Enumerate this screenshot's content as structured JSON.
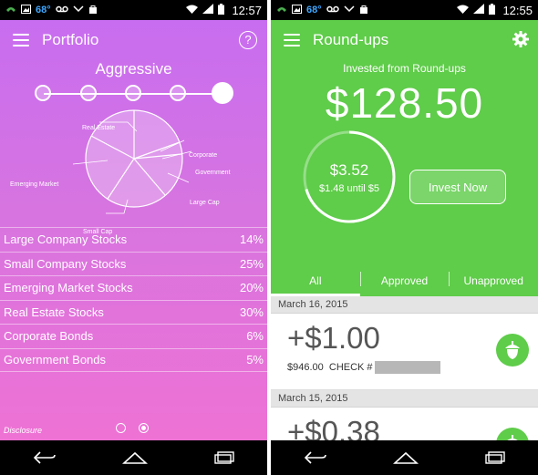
{
  "status_left": {
    "temp": "68°",
    "time": "12:57"
  },
  "status_right": {
    "temp": "68°",
    "time": "12:55"
  },
  "portfolio": {
    "title": "Portfolio",
    "help": "?",
    "risk_level": "Aggressive",
    "risk_steps": 5,
    "risk_selected": 5,
    "pie_labels": {
      "real_estate": "Real Estate",
      "corporate": "Corporate",
      "government": "Government",
      "emerging": "Emerging Market",
      "large_cap": "Large Cap",
      "small_cap": "Small Cap"
    },
    "allocations": [
      {
        "name": "Large Company Stocks",
        "pct": "14%"
      },
      {
        "name": "Small Company Stocks",
        "pct": "25%"
      },
      {
        "name": "Emerging Market Stocks",
        "pct": "20%"
      },
      {
        "name": "Real Estate Stocks",
        "pct": "30%"
      },
      {
        "name": "Corporate Bonds",
        "pct": "6%"
      },
      {
        "name": "Government Bonds",
        "pct": "5%"
      }
    ],
    "disclosure": "Disclosure",
    "page_count": 2,
    "page_selected": 2
  },
  "roundups": {
    "title": "Round-ups",
    "invested_label": "Invested from Round-ups",
    "invested_amount": "$128.50",
    "pending_amount": "$3.52",
    "until_text": "$1.48 until $5",
    "progress_fraction": 0.704,
    "invest_button": "Invest Now",
    "tabs": [
      {
        "label": "All",
        "active": true
      },
      {
        "label": "Approved",
        "active": false
      },
      {
        "label": "Unapproved",
        "active": false
      }
    ],
    "groups": [
      {
        "date": "March 16, 2015",
        "amount": "+$1.00",
        "detail": "$946.00  CHECK #"
      },
      {
        "date": "March 15, 2015",
        "amount": "+$0.38",
        "detail": ""
      }
    ]
  },
  "colors": {
    "purple_top": "#c86df0",
    "pink_bottom": "#ee72d4",
    "green": "#5fcc4a"
  }
}
